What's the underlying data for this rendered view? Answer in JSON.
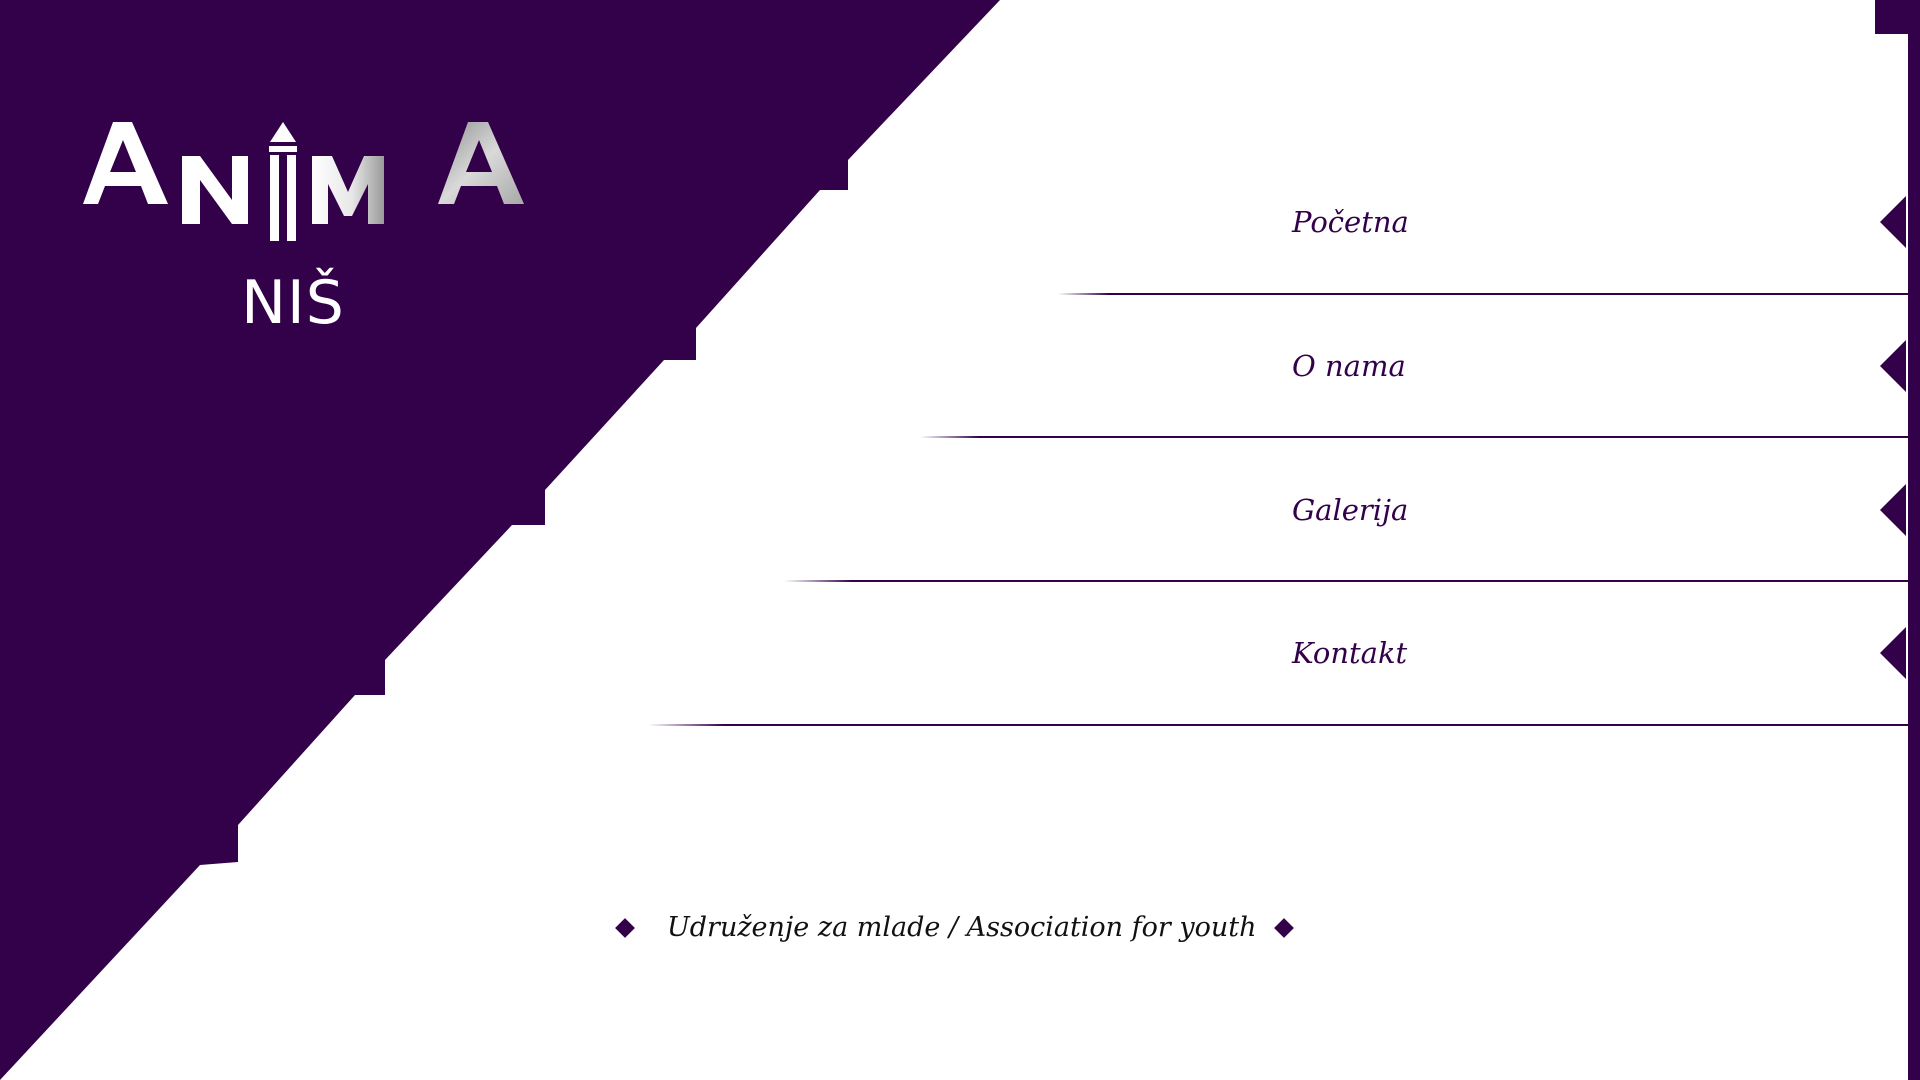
{
  "brand": {
    "logo_wordmark": "ANIMA",
    "city": "NIŠ",
    "primary_color": "#33004a",
    "accent_silver": "#bdbdbd"
  },
  "nav": {
    "items": [
      {
        "label": "Početna",
        "icon": "triangle-left-icon"
      },
      {
        "label": "O nama",
        "icon": "triangle-left-icon"
      },
      {
        "label": "Galerija",
        "icon": "triangle-left-icon"
      },
      {
        "label": "Kontakt",
        "icon": "triangle-left-icon"
      }
    ]
  },
  "footer": {
    "tagline": "Udruženje za mlade / Association for youth",
    "bullet_icon": "diamond-icon"
  }
}
